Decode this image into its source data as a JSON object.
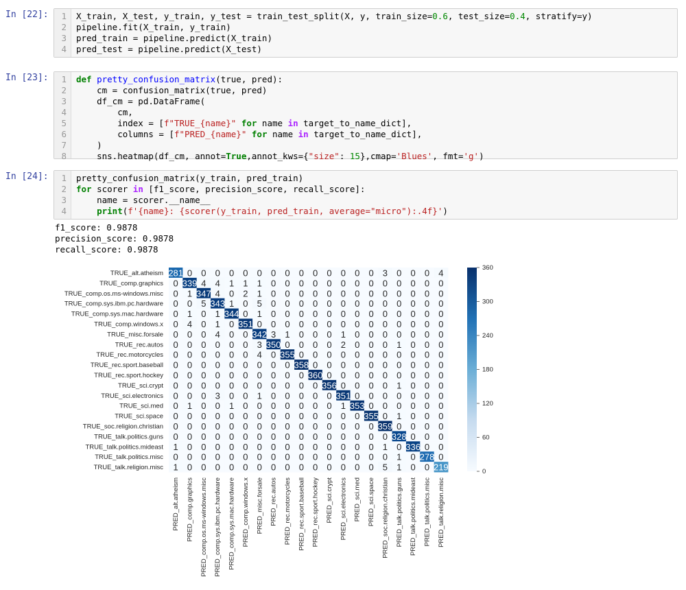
{
  "cells": [
    {
      "prompt": "In [22]:",
      "lines": [
        [
          [
            "X_train, X_test, y_train, y_test = train_test_split(X, y, train_size=",
            ""
          ],
          [
            "0.6",
            "num"
          ],
          [
            ", test_size=",
            ""
          ],
          [
            "0.4",
            "num"
          ],
          [
            ", stratify=y)",
            ""
          ]
        ],
        [
          [
            "pipeline.fit(X_train, y_train)",
            ""
          ]
        ],
        [
          [
            "pred_train = pipeline.predict(X_train)",
            ""
          ]
        ],
        [
          [
            "pred_test = pipeline.predict(X_test)",
            ""
          ]
        ]
      ]
    },
    {
      "prompt": "In [23]:",
      "lines": [
        [
          [
            "def ",
            "kw"
          ],
          [
            "pretty_confusion_matrix",
            "fn"
          ],
          [
            "(true, pred):",
            ""
          ]
        ],
        [
          [
            "    cm = confusion_matrix(true, pred)",
            ""
          ]
        ],
        [
          [
            "    df_cm = pd.DataFrame(",
            ""
          ]
        ],
        [
          [
            "        cm,",
            ""
          ]
        ],
        [
          [
            "        index = [",
            ""
          ],
          [
            "f\"TRUE_{name}\"",
            "str"
          ],
          [
            " ",
            ""
          ],
          [
            "for",
            "kw"
          ],
          [
            " name ",
            ""
          ],
          [
            "in",
            "op"
          ],
          [
            " target_to_name_dict],",
            ""
          ]
        ],
        [
          [
            "        columns = [",
            ""
          ],
          [
            "f\"PRED_{name}\"",
            "str"
          ],
          [
            " ",
            ""
          ],
          [
            "for",
            "kw"
          ],
          [
            " name ",
            ""
          ],
          [
            "in",
            "op"
          ],
          [
            " target_to_name_dict],",
            ""
          ]
        ],
        [
          [
            "    )",
            ""
          ]
        ],
        [
          [
            "    sns.heatmap(df_cm, annot=",
            ""
          ],
          [
            "True",
            "kw"
          ],
          [
            ",annot_kws={",
            ""
          ],
          [
            "\"size\"",
            "str"
          ],
          [
            ": ",
            ""
          ],
          [
            "15",
            "num"
          ],
          [
            "},cmap=",
            ""
          ],
          [
            "'Blues'",
            "str"
          ],
          [
            ", fmt=",
            ""
          ],
          [
            "'g'",
            "str"
          ],
          [
            ")",
            ""
          ]
        ]
      ]
    },
    {
      "prompt": "In [24]:",
      "lines": [
        [
          [
            "pretty_confusion_matrix(y_train, pred_train)",
            ""
          ]
        ],
        [
          [
            "for",
            "kw"
          ],
          [
            " scorer ",
            ""
          ],
          [
            "in",
            "op"
          ],
          [
            " [f1_score, precision_score, recall_score]:",
            ""
          ]
        ],
        [
          [
            "    name = scorer.__name__",
            ""
          ]
        ],
        [
          [
            "    ",
            ""
          ],
          [
            "print",
            "kw"
          ],
          [
            "(",
            ""
          ],
          [
            "f'{name}: {scorer(y_train, pred_train, average=\"micro\"):.4f}'",
            "str"
          ],
          [
            ")",
            ""
          ]
        ]
      ]
    }
  ],
  "output_lines": [
    "f1_score: 0.9878",
    "precision_score: 0.9878",
    "recall_score: 0.9878"
  ],
  "chart_data": {
    "type": "heatmap",
    "row_labels": [
      "TRUE_alt.atheism",
      "TRUE_comp.graphics",
      "TRUE_comp.os.ms-windows.misc",
      "TRUE_comp.sys.ibm.pc.hardware",
      "TRUE_comp.sys.mac.hardware",
      "TRUE_comp.windows.x",
      "TRUE_misc.forsale",
      "TRUE_rec.autos",
      "TRUE_rec.motorcycles",
      "TRUE_rec.sport.baseball",
      "TRUE_rec.sport.hockey",
      "TRUE_sci.crypt",
      "TRUE_sci.electronics",
      "TRUE_sci.med",
      "TRUE_sci.space",
      "TRUE_soc.religion.christian",
      "TRUE_talk.politics.guns",
      "TRUE_talk.politics.mideast",
      "TRUE_talk.politics.misc",
      "TRUE_talk.religion.misc"
    ],
    "col_labels": [
      "PRED_alt.atheism",
      "PRED_comp.graphics",
      "PRED_comp.os.ms-windows.misc",
      "PRED_comp.sys.ibm.pc.hardware",
      "PRED_comp.sys.mac.hardware",
      "PRED_comp.windows.x",
      "PRED_misc.forsale",
      "PRED_rec.autos",
      "PRED_rec.motorcycles",
      "PRED_rec.sport.baseball",
      "PRED_rec.sport.hockey",
      "PRED_sci.crypt",
      "PRED_sci.electronics",
      "PRED_sci.med",
      "PRED_sci.space",
      "PRED_soc.religion.christian",
      "PRED_talk.politics.guns",
      "PRED_talk.politics.mideast",
      "PRED_talk.politics.misc",
      "PRED_talk.religion.misc"
    ],
    "values": [
      [
        281,
        0,
        0,
        0,
        0,
        0,
        0,
        0,
        0,
        0,
        0,
        0,
        0,
        0,
        0,
        3,
        0,
        0,
        0,
        4
      ],
      [
        0,
        339,
        4,
        4,
        1,
        1,
        1,
        0,
        0,
        0,
        0,
        0,
        0,
        0,
        0,
        0,
        0,
        0,
        0,
        0
      ],
      [
        0,
        1,
        347,
        4,
        0,
        2,
        1,
        0,
        0,
        0,
        0,
        0,
        0,
        0,
        0,
        0,
        0,
        0,
        0,
        0
      ],
      [
        0,
        0,
        5,
        343,
        1,
        0,
        5,
        0,
        0,
        0,
        0,
        0,
        0,
        0,
        0,
        0,
        0,
        0,
        0,
        0
      ],
      [
        0,
        1,
        0,
        1,
        344,
        0,
        1,
        0,
        0,
        0,
        0,
        0,
        0,
        0,
        0,
        0,
        0,
        0,
        0,
        0
      ],
      [
        0,
        4,
        0,
        1,
        0,
        351,
        0,
        0,
        0,
        0,
        0,
        0,
        0,
        0,
        0,
        0,
        0,
        0,
        0,
        0
      ],
      [
        0,
        0,
        0,
        4,
        0,
        0,
        342,
        3,
        1,
        0,
        0,
        0,
        1,
        0,
        0,
        0,
        0,
        0,
        0,
        0
      ],
      [
        0,
        0,
        0,
        0,
        0,
        0,
        3,
        350,
        0,
        0,
        0,
        0,
        2,
        0,
        0,
        0,
        1,
        0,
        0,
        0
      ],
      [
        0,
        0,
        0,
        0,
        0,
        0,
        4,
        0,
        355,
        0,
        0,
        0,
        0,
        0,
        0,
        0,
        0,
        0,
        0,
        0
      ],
      [
        0,
        0,
        0,
        0,
        0,
        0,
        0,
        0,
        0,
        358,
        0,
        0,
        0,
        0,
        0,
        0,
        0,
        0,
        0,
        0
      ],
      [
        0,
        0,
        0,
        0,
        0,
        0,
        0,
        0,
        0,
        0,
        360,
        0,
        0,
        0,
        0,
        0,
        0,
        0,
        0,
        0
      ],
      [
        0,
        0,
        0,
        0,
        0,
        0,
        0,
        0,
        0,
        0,
        0,
        356,
        0,
        0,
        0,
        0,
        1,
        0,
        0,
        0
      ],
      [
        0,
        0,
        0,
        3,
        0,
        0,
        1,
        0,
        0,
        0,
        0,
        0,
        351,
        0,
        0,
        0,
        0,
        0,
        0,
        0
      ],
      [
        0,
        1,
        0,
        0,
        1,
        0,
        0,
        0,
        0,
        0,
        0,
        0,
        1,
        353,
        0,
        0,
        0,
        0,
        0,
        0
      ],
      [
        0,
        0,
        0,
        0,
        0,
        0,
        0,
        0,
        0,
        0,
        0,
        0,
        0,
        0,
        355,
        0,
        1,
        0,
        0,
        0
      ],
      [
        0,
        0,
        0,
        0,
        0,
        0,
        0,
        0,
        0,
        0,
        0,
        0,
        0,
        0,
        0,
        359,
        0,
        0,
        0,
        0
      ],
      [
        0,
        0,
        0,
        0,
        0,
        0,
        0,
        0,
        0,
        0,
        0,
        0,
        0,
        0,
        0,
        0,
        328,
        0,
        0,
        0
      ],
      [
        1,
        0,
        0,
        0,
        0,
        0,
        0,
        0,
        0,
        0,
        0,
        0,
        0,
        0,
        0,
        1,
        0,
        336,
        0,
        0
      ],
      [
        0,
        0,
        0,
        0,
        0,
        0,
        0,
        0,
        0,
        0,
        0,
        0,
        0,
        0,
        0,
        0,
        1,
        0,
        278,
        0
      ],
      [
        1,
        0,
        0,
        0,
        0,
        0,
        0,
        0,
        0,
        0,
        0,
        0,
        0,
        0,
        0,
        5,
        1,
        0,
        0,
        219
      ]
    ],
    "colorbar_ticks": [
      0,
      60,
      120,
      180,
      240,
      300,
      360
    ],
    "vmin": 0,
    "vmax": 360,
    "cmap": "Blues"
  },
  "colors": {
    "prompt": "#303f9f",
    "cmap_low": "#f7fbff",
    "cmap_high": "#08306b"
  }
}
